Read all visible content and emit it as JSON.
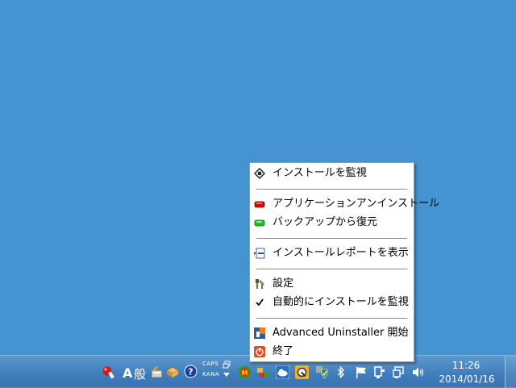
{
  "menu": {
    "items": [
      {
        "label": "インストールを監視",
        "icon": "monitor-install-icon"
      },
      {
        "label": "アプリケーションアンインストール",
        "icon": "red-uninstall-icon"
      },
      {
        "label": "バックアップから復元",
        "icon": "green-restore-icon"
      },
      {
        "label": "インストールレポートを表示",
        "icon": "report-icon"
      },
      {
        "label": "設定",
        "icon": "tools-icon"
      },
      {
        "label": "自動的にインストールを監視",
        "icon": "checkmark-icon",
        "checked": true
      },
      {
        "label": "Advanced Uninstaller 開始",
        "icon": "advanced-uninstaller-icon"
      },
      {
        "label": "終了",
        "icon": "power-icon"
      }
    ]
  },
  "taskbar": {
    "ime_mode": "A",
    "ime_han": "般",
    "caps": "CAPS",
    "kana": "KANA",
    "time": "11:26",
    "date": "2014/01/16"
  },
  "colors": {
    "desktop": "#4593d1",
    "taskbar": "#3f7cbc",
    "menu_bg": "#ffffff"
  }
}
